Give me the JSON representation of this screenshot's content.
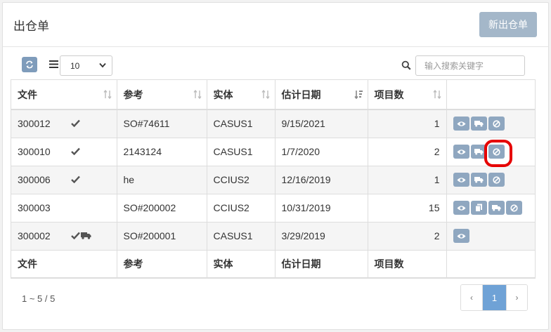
{
  "header": {
    "title": "出仓单",
    "new_button": "新出仓单"
  },
  "toolbar": {
    "page_size": "10",
    "search_placeholder": "输入搜索关键字"
  },
  "table": {
    "columns": [
      "文件",
      "参考",
      "实体",
      "估计日期",
      "项目数"
    ],
    "rows": [
      {
        "id": "300012",
        "status": "check",
        "ref": "SO#74611",
        "entity": "CASUS1",
        "date": "9/15/2021",
        "count": "1",
        "actions": [
          "view",
          "ship",
          "cancel"
        ]
      },
      {
        "id": "300010",
        "status": "check",
        "ref": "2143124",
        "entity": "CASUS1",
        "date": "1/7/2020",
        "count": "2",
        "actions": [
          "view",
          "ship",
          "cancel"
        ]
      },
      {
        "id": "300006",
        "status": "check",
        "ref": "he",
        "entity": "CCIUS2",
        "date": "12/16/2019",
        "count": "1",
        "actions": [
          "view",
          "ship",
          "cancel"
        ]
      },
      {
        "id": "300003",
        "status": "",
        "ref": "SO#200002",
        "entity": "CCIUS2",
        "date": "10/31/2019",
        "count": "15",
        "actions": [
          "view",
          "copy",
          "ship",
          "cancel"
        ]
      },
      {
        "id": "300002",
        "status": "check-truck",
        "ref": "SO#200001",
        "entity": "CASUS1",
        "date": "3/29/2019",
        "count": "2",
        "actions": [
          "view"
        ]
      }
    ]
  },
  "pagination": {
    "info": "1 ~ 5 / 5",
    "prev": "‹",
    "current": "1",
    "next": "›"
  },
  "colors": {
    "accent": "#8fa7c0",
    "active_page": "#6fa2d6",
    "highlight": "#e60000"
  }
}
